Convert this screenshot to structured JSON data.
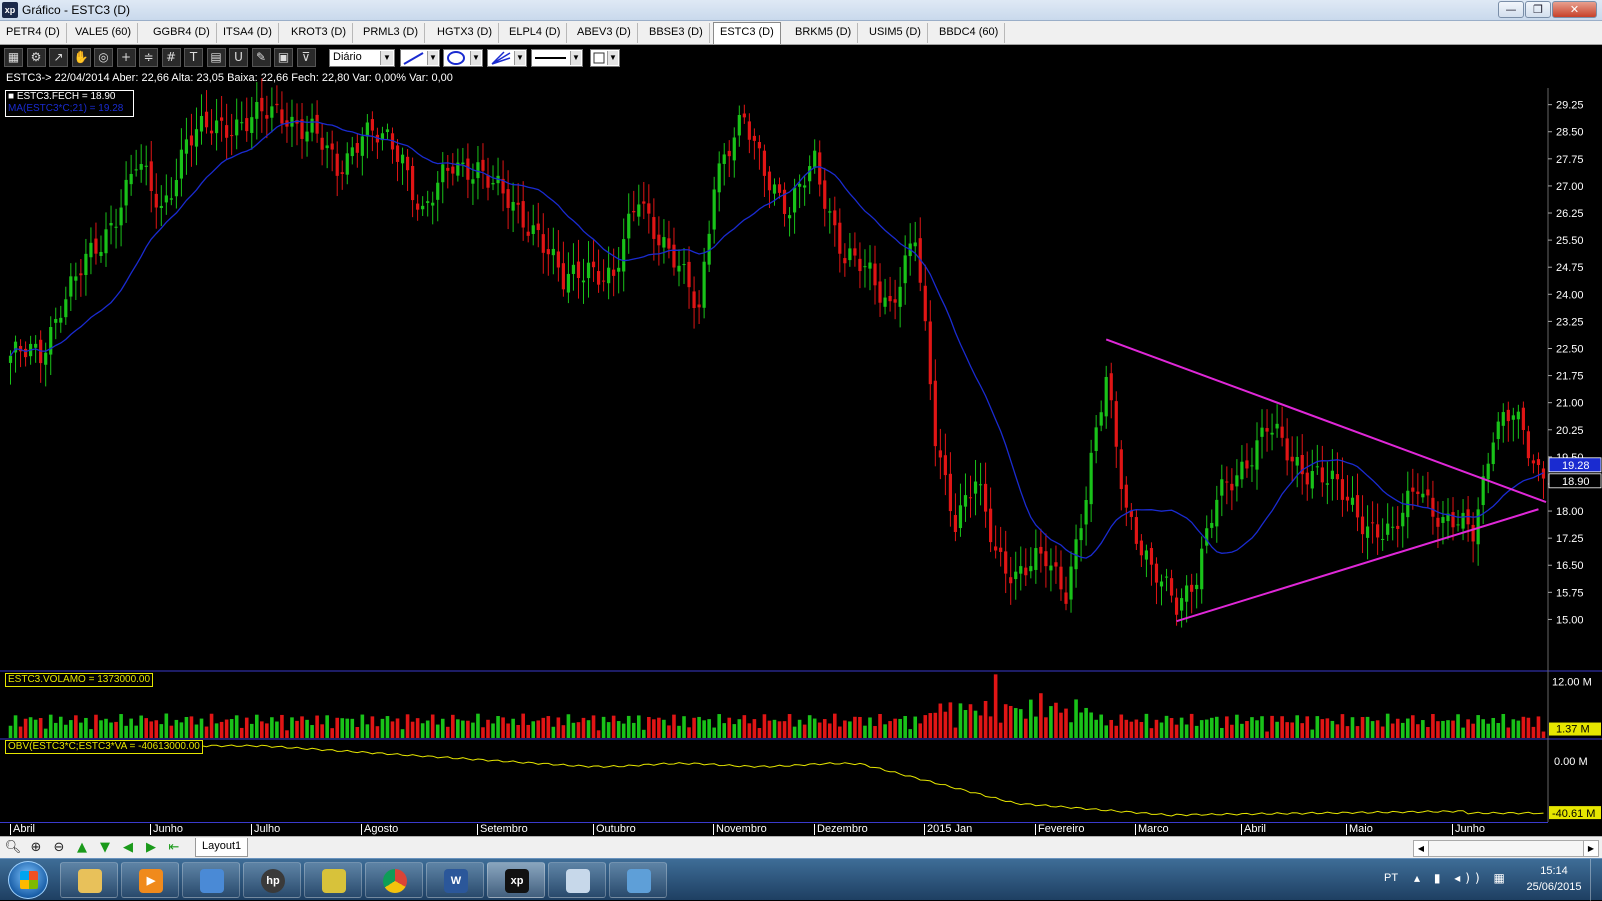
{
  "window": {
    "title": "Gráfico - ESTC3 (D)",
    "logo": "xp",
    "min": "—",
    "max": "❐",
    "close": "✕"
  },
  "tabs": [
    "PETR4 (D)",
    "VALE5 (60)",
    "GGBR4 (D)",
    "ITSA4 (D)",
    "KROT3 (D)",
    "PRML3 (D)",
    "HGTX3 (D)",
    "ELPL4 (D)",
    "ABEV3 (D)",
    "BBSE3 (D)",
    "ESTC3 (D)",
    "BRKM5 (D)",
    "USIM5 (D)",
    "BBDC4 (60)"
  ],
  "active_tab": "ESTC3 (D)",
  "toolbar": {
    "period": "Diário",
    "icons": [
      "chart-type-icon",
      "settings-icon",
      "line-tool-icon",
      "hand-icon",
      "zoom-icon",
      "crosshair-icon",
      "fibonacci-icon",
      "grid-icon",
      "text-icon",
      "calculator-icon",
      "magnet-icon",
      "brush-icon",
      "clipboard-icon",
      "filter-icon"
    ]
  },
  "info_line": "ESTC3-> 22/04/2014 Aber: 22,66 Alta: 23,05 Baixa: 22,66 Fech: 22,80 Var: 0,00% Var: 0,00",
  "legend": {
    "close": "ESTC3.FECH = 18.90",
    "ma": "MA(ESTC3*C;21) = 19.28"
  },
  "volume_label": "ESTC3.VOLAMO = 1373000.00",
  "obv_label": "OBV(ESTC3*C;ESTC3*VA = -40613000.00",
  "colors": {
    "up": "#19c219",
    "down": "#e01515",
    "ma": "#1a2bd0",
    "trendline": "#e028d8",
    "obv": "#e6e600",
    "axis_line": "#3a3acc"
  },
  "chart_data": {
    "type": "candlestick",
    "title": "ESTC3 (D)",
    "price_axis": {
      "ticks": [
        "29.25",
        "28.50",
        "27.75",
        "27.00",
        "26.25",
        "25.50",
        "24.75",
        "24.00",
        "23.25",
        "22.50",
        "21.75",
        "21.00",
        "20.25",
        "19.50",
        "18.75",
        "18.00",
        "17.25",
        "16.50",
        "15.75",
        "15.00"
      ],
      "range": [
        13.6,
        29.6
      ]
    },
    "price_badges": {
      "ma": "19.28",
      "close": "18.90"
    },
    "volume_axis": {
      "ticks": [
        "12.00 M"
      ],
      "badge": "1.37 M",
      "range": [
        0,
        14
      ]
    },
    "obv_axis": {
      "ticks": [
        "0.00 M"
      ],
      "badge": "-40.61 M",
      "range": [
        -46,
        15
      ]
    },
    "months": [
      "Abril",
      "Junho",
      "Julho",
      "Agosto",
      "Setembro",
      "Outubro",
      "Novembro",
      "Dezembro",
      "2015 Jan",
      "Fevereiro",
      "Marco",
      "Abril",
      "Maio",
      "Junho"
    ],
    "month_start_index": [
      0,
      28,
      48,
      70,
      93,
      116,
      140,
      160,
      182,
      204,
      224,
      245,
      266,
      287
    ],
    "bar_count": 306,
    "close_anchors": [
      [
        0,
        22.3
      ],
      [
        6,
        22.3
      ],
      [
        10,
        23.8
      ],
      [
        18,
        25.4
      ],
      [
        25,
        27.6
      ],
      [
        30,
        26.3
      ],
      [
        35,
        28.3
      ],
      [
        45,
        28.8
      ],
      [
        55,
        29.0
      ],
      [
        60,
        28.5
      ],
      [
        65,
        27.4
      ],
      [
        70,
        28.6
      ],
      [
        78,
        27.8
      ],
      [
        82,
        26.3
      ],
      [
        88,
        27.5
      ],
      [
        93,
        27.6
      ],
      [
        98,
        26.6
      ],
      [
        105,
        25.8
      ],
      [
        110,
        24.2
      ],
      [
        115,
        24.9
      ],
      [
        120,
        24.3
      ],
      [
        125,
        26.8
      ],
      [
        131,
        25.1
      ],
      [
        137,
        23.6
      ],
      [
        140,
        27.3
      ],
      [
        146,
        28.7
      ],
      [
        150,
        27.6
      ],
      [
        155,
        26.2
      ],
      [
        160,
        27.7
      ],
      [
        166,
        25.0
      ],
      [
        171,
        24.5
      ],
      [
        175,
        23.8
      ],
      [
        180,
        25.5
      ],
      [
        184,
        20.1
      ],
      [
        188,
        17.8
      ],
      [
        192,
        18.7
      ],
      [
        196,
        16.9
      ],
      [
        200,
        16.3
      ],
      [
        206,
        16.6
      ],
      [
        210,
        15.9
      ],
      [
        214,
        18.4
      ],
      [
        218,
        21.6
      ],
      [
        222,
        18.2
      ],
      [
        227,
        16.2
      ],
      [
        232,
        15.5
      ],
      [
        236,
        16.3
      ],
      [
        240,
        18.2
      ],
      [
        246,
        19.5
      ],
      [
        250,
        20.3
      ],
      [
        255,
        19.4
      ],
      [
        260,
        19.1
      ],
      [
        265,
        18.4
      ],
      [
        270,
        17.7
      ],
      [
        275,
        17.2
      ],
      [
        280,
        18.9
      ],
      [
        285,
        17.6
      ],
      [
        291,
        17.5
      ],
      [
        295,
        20.3
      ],
      [
        299,
        20.6
      ],
      [
        302,
        19.7
      ],
      [
        305,
        18.9
      ]
    ],
    "ma_period": 21,
    "trendlines": [
      {
        "name": "resistance",
        "from": [
          218,
          22.75
        ],
        "to": [
          306,
          18.25
        ]
      },
      {
        "name": "support",
        "from": [
          232,
          14.95
        ],
        "to": [
          304,
          18.05
        ]
      }
    ],
    "ylabel": "",
    "xlabel": ""
  },
  "bottom": {
    "layout_tab": "Layout1",
    "nav": [
      "search-icon",
      "zoom-in-icon",
      "zoom-out-icon",
      "arrow-up-icon",
      "arrow-down-icon",
      "arrow-left-icon",
      "arrow-right-icon",
      "arrow-end-icon"
    ],
    "scroll_left": "◀",
    "scroll_right": "▶"
  },
  "taskbar": {
    "apps": [
      "explorer",
      "media-player",
      "network",
      "hp",
      "notepad-pro",
      "chrome",
      "word",
      "xp",
      "paint",
      "photos"
    ],
    "lang": "PT",
    "time": "15:14",
    "date": "25/06/2015"
  }
}
